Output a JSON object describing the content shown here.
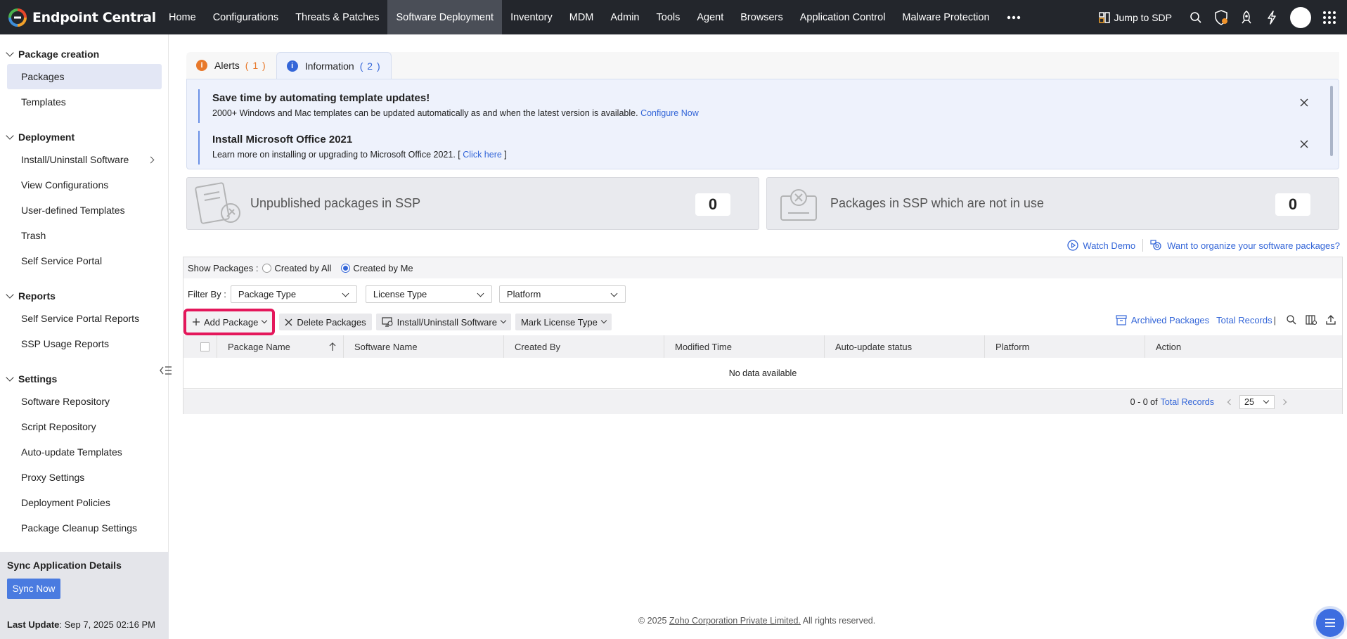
{
  "brand": {
    "name": "Endpoint Central"
  },
  "nav": [
    "Home",
    "Configurations",
    "Threats & Patches",
    "Software Deployment",
    "Inventory",
    "MDM",
    "Admin",
    "Tools",
    "Agent",
    "Browsers",
    "Application Control",
    "Malware Protection"
  ],
  "nav_active": "Software Deployment",
  "topright": {
    "jump_label": "Jump to SDP"
  },
  "sidebar": {
    "sections": [
      {
        "title": "Package creation",
        "items": [
          "Packages",
          "Templates"
        ]
      },
      {
        "title": "Deployment",
        "items": [
          "Install/Uninstall Software",
          "View Configurations",
          "User-defined Templates",
          "Trash",
          "Self Service Portal"
        ]
      },
      {
        "title": "Reports",
        "items": [
          "Self Service Portal Reports",
          "SSP Usage Reports"
        ]
      },
      {
        "title": "Settings",
        "items": [
          "Software Repository",
          "Script Repository",
          "Auto-update Templates",
          "Proxy Settings",
          "Deployment Policies",
          "Package Cleanup Settings"
        ]
      }
    ],
    "active_item": "Packages",
    "sync": {
      "title": "Sync Application Details",
      "button": "Sync Now",
      "last_update_label": "Last Update",
      "last_update_value": ": Sep 7, 2025 02:16 PM"
    }
  },
  "tabs": [
    {
      "label": "Alerts",
      "count": "( 1 )",
      "color": "#e8792b"
    },
    {
      "label": "Information",
      "count": "( 2 )",
      "color": "#3466d8"
    }
  ],
  "notices": [
    {
      "title": "Save time by automating template updates!",
      "text": "2000+ Windows and Mac templates can be updated automatically as and when the latest version is available.",
      "link": "Configure Now",
      "suffix": ""
    },
    {
      "title": "Install Microsoft Office 2021",
      "text": "Learn more on installing or upgrading to Microsoft Office 2021. [",
      "link": "Click here",
      "suffix": "]"
    }
  ],
  "cards": [
    {
      "label": "Unpublished packages in SSP",
      "value": "0"
    },
    {
      "label": "Packages in SSP which are not in use",
      "value": "0"
    }
  ],
  "help": {
    "watch_demo": "Watch Demo",
    "organize": "Want to organize your software packages?"
  },
  "show_packages": {
    "label": "Show Packages :",
    "options": [
      "Created by All",
      "Created by Me"
    ],
    "selected": "Created by Me"
  },
  "filters": {
    "label": "Filter By :",
    "selects": [
      "Package Type",
      "License Type",
      "Platform"
    ]
  },
  "actions": {
    "add": "Add Package",
    "delete": "Delete Packages",
    "install": "Install/Uninstall Software",
    "mark": "Mark License Type"
  },
  "tools": {
    "archived": "Archived Packages",
    "total": "Total Records",
    "divider": "|"
  },
  "table": {
    "columns": [
      "Package Name",
      "Software Name",
      "Created By",
      "Modified Time",
      "Auto-update status",
      "Platform",
      "Action"
    ],
    "empty": "No data available"
  },
  "pager": {
    "range": "0 - 0 of",
    "total_link": "Total Records",
    "page_size": "25"
  },
  "footer": {
    "prefix": "© 2025",
    "company": "Zoho Corporation Private Limited.",
    "suffix": "All rights reserved."
  }
}
